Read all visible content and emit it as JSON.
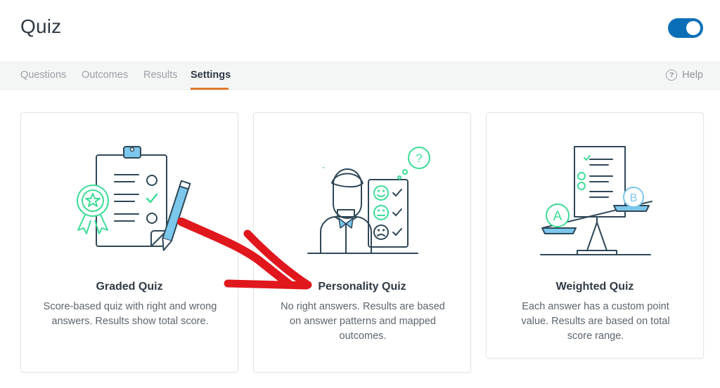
{
  "header": {
    "title": "Quiz",
    "toggle_on": true
  },
  "tabs": [
    {
      "label": "Questions",
      "active": false
    },
    {
      "label": "Outcomes",
      "active": false
    },
    {
      "label": "Results",
      "active": false
    },
    {
      "label": "Settings",
      "active": true
    }
  ],
  "help": {
    "label": "Help",
    "icon_glyph": "?",
    "icon": "help-circle-icon"
  },
  "cards": [
    {
      "title": "Graded Quiz",
      "description": "Score-based quiz with right and wrong answers. Results show total score.",
      "icon": "clipboard-checklist-icon"
    },
    {
      "title": "Personality Quiz",
      "description": "No right answers. Results are based on answer patterns and mapped outcomes.",
      "icon": "person-mood-checklist-icon"
    },
    {
      "title": "Weighted Quiz",
      "description": "Each answer has a custom point value. Results are based on total score range.",
      "icon": "balance-scale-icon"
    }
  ],
  "illustration_letters": {
    "scale_left": "A",
    "scale_right": "B",
    "question": "?"
  },
  "colors": {
    "accent_tab": "#e27730",
    "toggle": "#0b6fb7",
    "illustration_line": "#2f4858",
    "illustration_teal": "#3ddc97",
    "illustration_blue": "#7cc7ec",
    "annotation_arrow": "#e0171d"
  }
}
